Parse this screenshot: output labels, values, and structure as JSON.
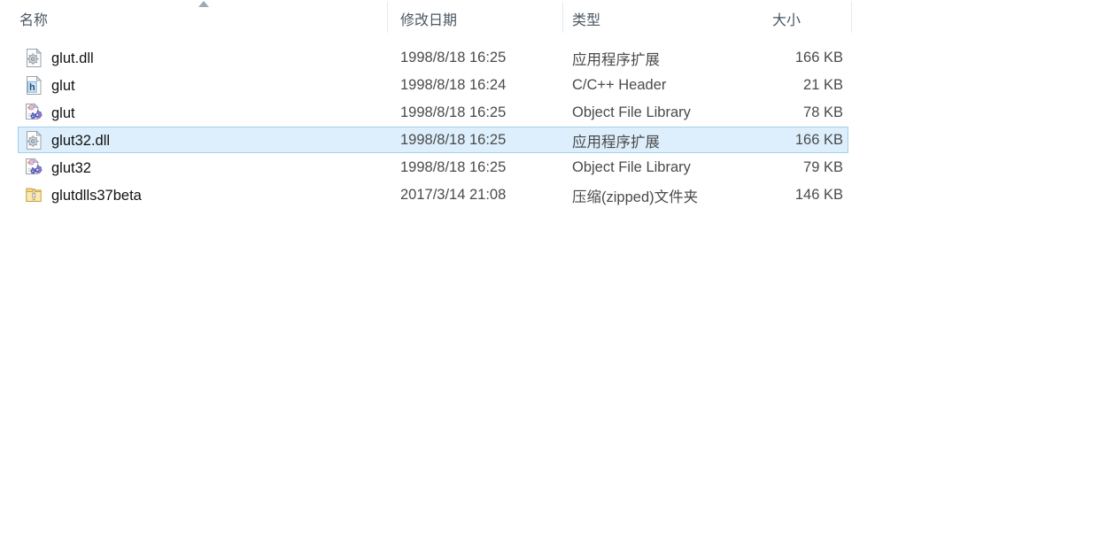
{
  "window": {
    "view_mode": "details"
  },
  "columns": {
    "name": {
      "label": "名称",
      "sort": "ascending",
      "sort_icon": "sort-ascending-triangle-icon"
    },
    "date_modified": {
      "label": "修改日期"
    },
    "type": {
      "label": "类型"
    },
    "size": {
      "label": "大小"
    }
  },
  "files": [
    {
      "name": "glut.dll",
      "date_modified": "1998/8/18 16:25",
      "type": "应用程序扩展",
      "size": "166 KB",
      "icon": "dll-file-icon",
      "selected": false
    },
    {
      "name": "glut",
      "date_modified": "1998/8/18 16:24",
      "type": "C/C++ Header",
      "size": "21 KB",
      "icon": "header-file-icon",
      "selected": false
    },
    {
      "name": "glut",
      "date_modified": "1998/8/18 16:25",
      "type": "Object File Library",
      "size": "78 KB",
      "icon": "object-library-file-icon",
      "selected": false
    },
    {
      "name": "glut32.dll",
      "date_modified": "1998/8/18 16:25",
      "type": "应用程序扩展",
      "size": "166 KB",
      "icon": "dll-file-icon",
      "selected": true
    },
    {
      "name": "glut32",
      "date_modified": "1998/8/18 16:25",
      "type": "Object File Library",
      "size": "79 KB",
      "icon": "object-library-file-icon",
      "selected": false
    },
    {
      "name": "glutdlls37beta",
      "date_modified": "2017/3/14 21:08",
      "type": "压缩(zipped)文件夹",
      "size": "146 KB",
      "icon": "zipped-folder-icon",
      "selected": false
    }
  ],
  "colors": {
    "background": "#ffffff",
    "header_text": "#4a5763",
    "row_text": "#111111",
    "meta_text": "#4a4a4a",
    "selection_fill": "#ddeffc",
    "selection_border": "#a4cfe8",
    "divider": "#e6e9ec"
  }
}
